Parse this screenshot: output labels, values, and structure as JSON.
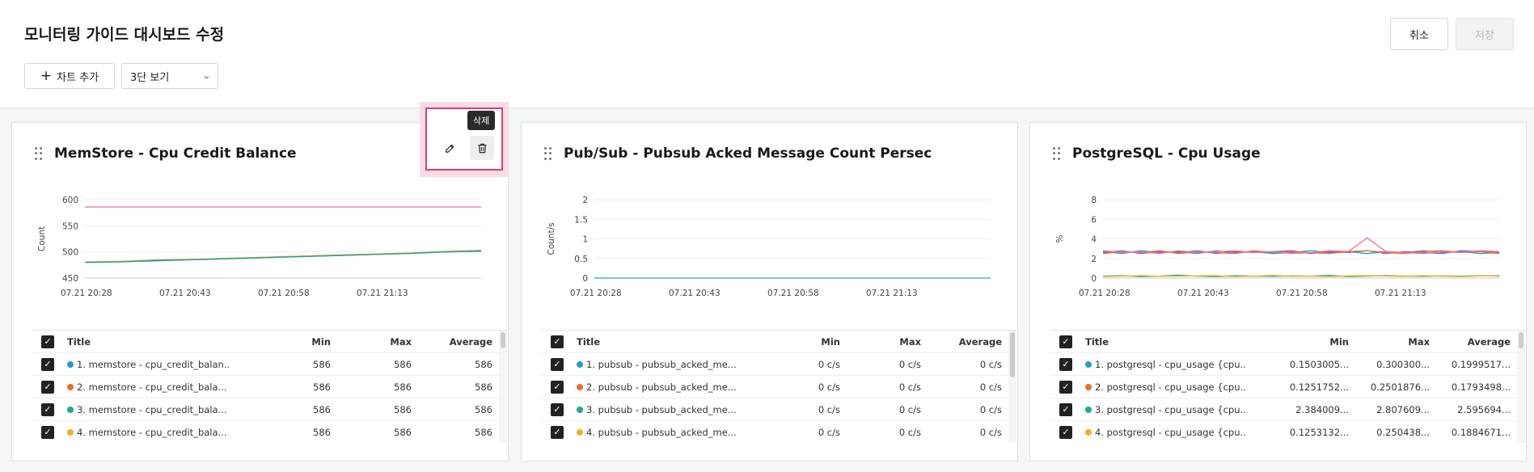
{
  "header": {
    "title": "모니터링 가이드 대시보드 수정",
    "cancel_label": "취소",
    "save_label": "저장",
    "add_chart_label": "차트 추가",
    "view_mode": "3단 보기"
  },
  "toolbar": {
    "delete_tooltip": "삭제"
  },
  "legend_headers": {
    "title": "Title",
    "min": "Min",
    "max": "Max",
    "average": "Average"
  },
  "colors": {
    "accent_pink": "#e13c7a",
    "series": [
      "#1fa0c8",
      "#f06b28",
      "#1fa898",
      "#f0b020",
      "#7a6ad8",
      "#f06fa0"
    ]
  },
  "panels": [
    {
      "title": "MemStore - Cpu Credit Balance",
      "rows": [
        {
          "title": "1. memstore - cpu_credit_balan...",
          "min": "586",
          "max": "586",
          "avg": "586"
        },
        {
          "title": "2. memstore - cpu_credit_bala...",
          "min": "586",
          "max": "586",
          "avg": "586"
        },
        {
          "title": "3. memstore - cpu_credit_bala...",
          "min": "586",
          "max": "586",
          "avg": "586"
        },
        {
          "title": "4. memstore - cpu_credit_bala...",
          "min": "586",
          "max": "586",
          "avg": "586"
        }
      ]
    },
    {
      "title": "Pub/Sub - Pubsub Acked Message Count Persec",
      "rows": [
        {
          "title": "1. pubsub - pubsub_acked_me...",
          "min": "0 c/s",
          "max": "0 c/s",
          "avg": "0 c/s"
        },
        {
          "title": "2. pubsub - pubsub_acked_me...",
          "min": "0 c/s",
          "max": "0 c/s",
          "avg": "0 c/s"
        },
        {
          "title": "3. pubsub - pubsub_acked_me...",
          "min": "0 c/s",
          "max": "0 c/s",
          "avg": "0 c/s"
        },
        {
          "title": "4. pubsub - pubsub_acked_me...",
          "min": "0 c/s",
          "max": "0 c/s",
          "avg": "0 c/s"
        }
      ]
    },
    {
      "title": "PostgreSQL - Cpu Usage",
      "rows": [
        {
          "title": "1. postgresql - cpu_usage {cpu...",
          "min": "0.1503005...",
          "max": "0.300300...",
          "avg": "0.1999517..."
        },
        {
          "title": "2. postgresql - cpu_usage {cpu...",
          "min": "0.1251752...",
          "max": "0.2501876...",
          "avg": "0.1793498..."
        },
        {
          "title": "3. postgresql - cpu_usage {cpu...",
          "min": "2.384009...",
          "max": "2.807609...",
          "avg": "2.595694..."
        },
        {
          "title": "4. postgresql - cpu_usage {cpu...",
          "min": "0.1253132...",
          "max": "0.250438...",
          "avg": "0.1884671..."
        }
      ]
    }
  ],
  "chart_data": [
    {
      "type": "line",
      "ylabel": "Count",
      "ylim": [
        450,
        600
      ],
      "yticks": [
        "450",
        "500",
        "550",
        "600"
      ],
      "xticks": [
        "07.21 20:28",
        "07.21 20:43",
        "07.21 20:58",
        "07.21 21:13"
      ],
      "grid": true,
      "series": [
        {
          "values": [
            586,
            586,
            586,
            586,
            586,
            586,
            586,
            586,
            586,
            586,
            586,
            586
          ],
          "color": "#f06fa0"
        },
        {
          "values": [
            481,
            482,
            485,
            486,
            488,
            490,
            492,
            494,
            496,
            498,
            501,
            503
          ],
          "color": "#f0b020"
        },
        {
          "values": [
            480,
            481,
            484,
            485,
            487,
            489,
            491,
            493,
            495,
            497,
            500,
            502
          ],
          "color": "#7a6ad8"
        },
        {
          "values": [
            480,
            481,
            483,
            485,
            487,
            489,
            491,
            493,
            495,
            497,
            500,
            501
          ],
          "color": "#1fa898"
        }
      ]
    },
    {
      "type": "line",
      "ylabel": "Count/s",
      "ylim": [
        0,
        2
      ],
      "yticks": [
        "0",
        "0.5",
        "1",
        "1.5",
        "2"
      ],
      "xticks": [
        "07.21 20:28",
        "07.21 20:43",
        "07.21 20:58",
        "07.21 21:13"
      ],
      "grid": true,
      "series": [
        {
          "values": [
            0,
            0,
            0,
            0,
            0,
            0,
            0,
            0,
            0,
            0,
            0,
            0
          ],
          "color": "#1fa0c8"
        }
      ]
    },
    {
      "type": "line",
      "ylabel": "%",
      "ylim": [
        0,
        8
      ],
      "yticks": [
        "0",
        "2",
        "4",
        "6",
        "8"
      ],
      "xticks": [
        "07.21 20:28",
        "07.21 20:43",
        "07.21 20:58",
        "07.21 21:13"
      ],
      "grid": true,
      "series": [
        {
          "values": [
            2.7,
            2.5,
            2.8,
            2.6,
            2.7,
            2.5,
            2.8,
            2.6,
            2.7,
            2.5,
            2.6,
            2.8,
            2.6,
            2.7,
            2.5,
            2.7,
            2.6,
            2.8,
            2.6,
            2.7,
            2.5,
            2.6
          ],
          "color": "#1fa0c8"
        },
        {
          "values": [
            2.6,
            2.8,
            2.5,
            2.7,
            2.6,
            2.8,
            2.5,
            2.7,
            2.6,
            2.7,
            2.8,
            2.5,
            2.7,
            2.6,
            2.8,
            2.5,
            2.7,
            2.6,
            2.5,
            2.8,
            2.7,
            2.6
          ],
          "color": "#7a6ad8"
        },
        {
          "values": [
            2.5,
            2.7,
            2.6,
            2.8,
            2.5,
            2.7,
            2.6,
            2.5,
            2.8,
            2.6,
            2.7,
            2.6,
            2.5,
            2.7,
            2.8,
            2.6,
            2.5,
            2.7,
            2.8,
            2.6,
            2.7,
            2.5
          ],
          "color": "#f06b28"
        },
        {
          "values": [
            2.8,
            2.6,
            2.7,
            2.5,
            2.8,
            2.6,
            2.7,
            2.8,
            2.6,
            2.7,
            2.5,
            2.6,
            2.8,
            2.7,
            4.1,
            2.7,
            2.6,
            2.5,
            2.7,
            2.6,
            2.8,
            2.7
          ],
          "color": "#f06fa0"
        },
        {
          "values": [
            0.2,
            0.25,
            0.15,
            0.2,
            0.3,
            0.2,
            0.15,
            0.25,
            0.2,
            0.18,
            0.22,
            0.2,
            0.28,
            0.15,
            0.2,
            0.25,
            0.2,
            0.18,
            0.22,
            0.2,
            0.25,
            0.2
          ],
          "color": "#1fa898"
        },
        {
          "values": [
            0.15,
            0.2,
            0.25,
            0.18,
            0.2,
            0.22,
            0.25,
            0.15,
            0.2,
            0.28,
            0.18,
            0.2,
            0.15,
            0.22,
            0.25,
            0.2,
            0.18,
            0.25,
            0.2,
            0.15,
            0.22,
            0.25
          ],
          "color": "#f0b020"
        }
      ]
    }
  ]
}
